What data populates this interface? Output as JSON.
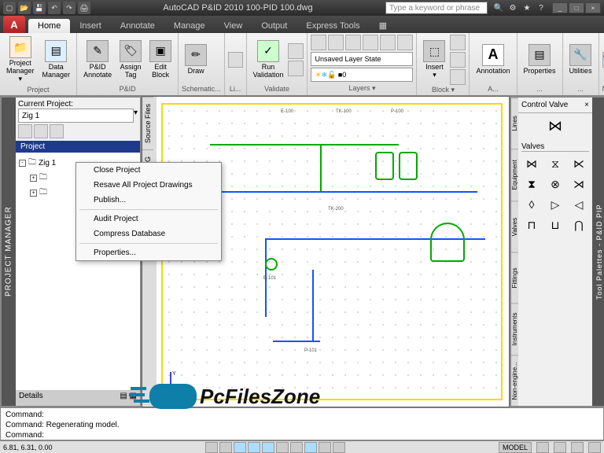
{
  "titlebar": {
    "title": "AutoCAD P&ID 2010    100-PID 100.dwg",
    "search_placeholder": "Type a keyword or phrase"
  },
  "tabs": [
    "Home",
    "Insert",
    "Annotate",
    "Manage",
    "View",
    "Output",
    "Express Tools"
  ],
  "active_tab": "Home",
  "ribbon": {
    "project": {
      "label": "Project",
      "project_manager": "Project\nManager ▾",
      "data_manager": "Data\nManager"
    },
    "pid": {
      "label": "P&ID",
      "annotate": "P&ID\nAnnotate",
      "assign_tag": "Assign\nTag",
      "edit_block": "Edit\nBlock"
    },
    "schematic": {
      "label": "Schematic...",
      "draw": "Draw"
    },
    "line": {
      "label": "Li..."
    },
    "validate": {
      "label": "Validate",
      "run": "Run\nValidation"
    },
    "layers": {
      "label": "Layers ▾",
      "combo": "Unsaved Layer State",
      "current": "0"
    },
    "block": {
      "label": "Block ▾",
      "insert": "Insert ▾"
    },
    "annotation": {
      "label": "A...",
      "btn": "Annotation"
    },
    "properties": {
      "label": "...",
      "btn": "Properties"
    },
    "utilities": {
      "label": "...",
      "btn": "Utilities"
    },
    "nav": {
      "label": "Nav..."
    }
  },
  "pm": {
    "title": "PROJECT MANAGER",
    "header": "Current Project:",
    "combo_value": "Zig 1",
    "tab": "Project",
    "tree_root": "Zig 1",
    "details": "Details"
  },
  "ctx_menu": {
    "items": [
      "Close Project",
      "Resave All Project Drawings",
      "Publish...",
      "",
      "Audit Project",
      "Compress Database",
      "",
      "Properties..."
    ]
  },
  "canvas_tabs": [
    "Source Files",
    "Isometric DWG"
  ],
  "drawing_labels": {
    "l1": "E-100",
    "l2": "TK-100",
    "l3": "P-100",
    "l4": "E-101",
    "l5": "TK-200",
    "l6": "P-101"
  },
  "toolpal": {
    "title": "Tool Palettes - P&ID PIP",
    "head": "Control Valve",
    "section": "Valves",
    "side_tabs": [
      "Lines",
      "Equipment",
      "Valves",
      "Fittings",
      "Instruments",
      "Non-engine..."
    ]
  },
  "cmdline": {
    "l1": "Command:",
    "l2": "Command: Regenerating model.",
    "l3": "Command:"
  },
  "statusbar": {
    "coords": "6.81, 6.31, 0.00",
    "model": "MODEL"
  },
  "watermark": "PcFilesZone"
}
